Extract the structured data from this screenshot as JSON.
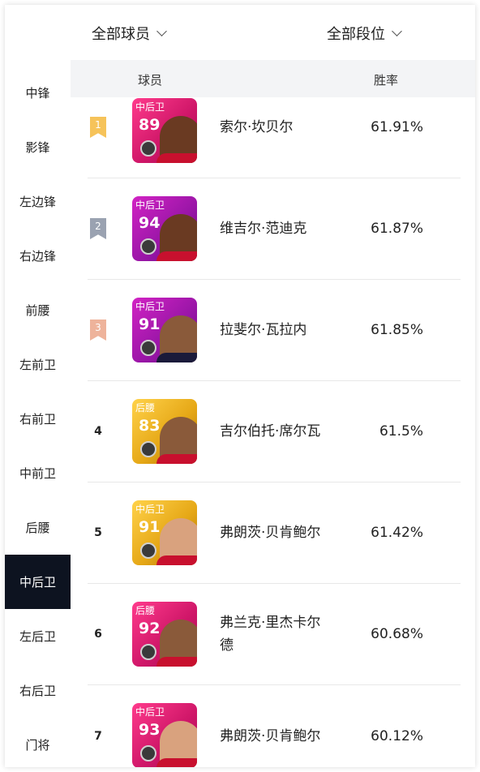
{
  "filters": {
    "player": "全部球员",
    "rank": "全部段位"
  },
  "table_header": {
    "player": "球员",
    "winrate": "胜率"
  },
  "sidebar": {
    "items": [
      "中锋",
      "影锋",
      "左边锋",
      "右边锋",
      "前腰",
      "左前卫",
      "右前卫",
      "中前卫",
      "后腰",
      "中后卫",
      "左后卫",
      "右后卫",
      "门将"
    ],
    "active": "中后卫"
  },
  "rows": [
    {
      "rank": "1",
      "pos": "中后卫",
      "rating": "89",
      "name": "索尔·坎贝尔",
      "winrate": "61.91%"
    },
    {
      "rank": "2",
      "pos": "中后卫",
      "rating": "94",
      "name": "维吉尔·范迪克",
      "winrate": "61.87%"
    },
    {
      "rank": "3",
      "pos": "中后卫",
      "rating": "91",
      "name": "拉斐尔·瓦拉内",
      "winrate": "61.85%"
    },
    {
      "rank": "4",
      "pos": "后腰",
      "rating": "83",
      "name": "吉尔伯托·席尔瓦",
      "winrate": "61.5%"
    },
    {
      "rank": "5",
      "pos": "中后卫",
      "rating": "91",
      "name": "弗朗茨·贝肯鲍尔",
      "winrate": "61.42%"
    },
    {
      "rank": "6",
      "pos": "后腰",
      "rating": "92",
      "name": "弗兰克·里杰卡尔德",
      "winrate": "60.68%"
    },
    {
      "rank": "7",
      "pos": "中后卫",
      "rating": "93",
      "name": "弗朗茨·贝肯鲍尔",
      "winrate": "60.12%"
    }
  ]
}
